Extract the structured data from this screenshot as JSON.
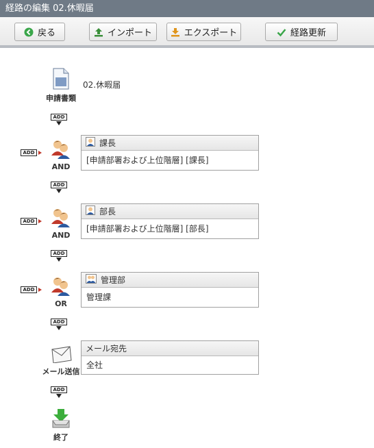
{
  "window": {
    "title": "経路の編集 02.休暇届"
  },
  "toolbar": {
    "back_label": "戻る",
    "import_label": "インポート",
    "export_label": "エクスポート",
    "update_label": "経路更新",
    "icons": {
      "back": "circle-arrow-left-icon",
      "import": "upload-icon",
      "export": "download-icon",
      "update": "checkmark-icon"
    },
    "colors": {
      "back": "#3aa64a",
      "import": "#3a8f3a",
      "export": "#e0951c",
      "update": "#3aa64a"
    }
  },
  "add_label": "ADD",
  "route": {
    "document": {
      "label": "申請書類",
      "title": "02.休暇届"
    },
    "steps": [
      {
        "type": "AND",
        "header": "課長",
        "body": "[申請部署および上位階層] [課長]",
        "icon": "person-icon"
      },
      {
        "type": "AND",
        "header": "部長",
        "body": "[申請部署および上位階層] [部長]",
        "icon": "person-icon"
      },
      {
        "type": "OR",
        "header": "管理部",
        "body": "管理課",
        "icon": "group-icon"
      }
    ],
    "mail": {
      "label": "メール送信",
      "header": "メール宛先",
      "body": "全社"
    },
    "end": {
      "label": "終了"
    }
  }
}
